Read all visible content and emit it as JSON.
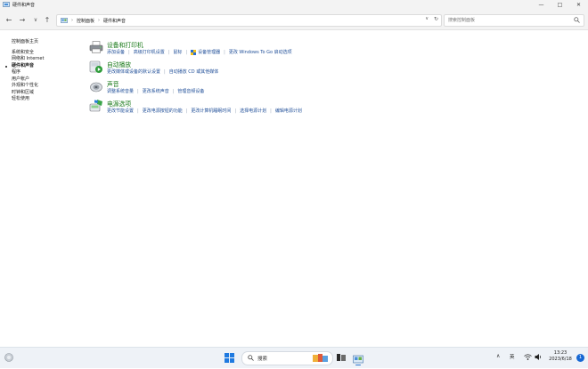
{
  "window": {
    "title": "硬件和声音",
    "controls": [
      "—",
      "□",
      "✕"
    ]
  },
  "nav": {
    "back": "←",
    "forward": "→",
    "history": "∨",
    "up": "↑"
  },
  "address": {
    "crumbs": [
      "控制面板",
      "硬件和声音"
    ],
    "separator": "›",
    "dropdown": "∨",
    "refresh": "↻"
  },
  "search": {
    "placeholder": "搜索控制面板"
  },
  "sidebar": {
    "home": "控制面板主页",
    "items": [
      "系统和安全",
      "网络和 Internet",
      "硬件和声音",
      "程序",
      "用户帐户",
      "外观和个性化",
      "时钟和区域",
      "轻松使用"
    ],
    "current_index": 2
  },
  "sections": [
    {
      "title": "设备和打印机",
      "icon": "printer-icon",
      "links": [
        "添加设备",
        "高级打印机设置",
        "鼠标",
        "设备管理器",
        "更改 Windows To Go 启动选项"
      ],
      "shield_link_index": 3
    },
    {
      "title": "自动播放",
      "icon": "autoplay-icon",
      "links": [
        "更改媒体或设备的默认设置",
        "自动播放 CD 或其他媒体"
      ]
    },
    {
      "title": "声音",
      "icon": "speaker-icon",
      "links": [
        "调整系统音量",
        "更改系统声音",
        "管理音频设备"
      ]
    },
    {
      "title": "电源选项",
      "icon": "power-plan-icon",
      "links": [
        "更改节能设置",
        "更改电源按钮的功能",
        "更改计算机睡眠时间",
        "选择电源计划",
        "编辑电源计划"
      ]
    }
  ],
  "taskbar": {
    "search_label": "搜索",
    "ime": "英",
    "tray_arrow": "∧",
    "time": "13:23",
    "date": "2023/6/18",
    "notification_count": "1"
  },
  "colors": {
    "section_title": "#1a7a1a",
    "link": "#1f4e98",
    "taskbar": "#eef2f7",
    "accent": "#2b76d2"
  }
}
